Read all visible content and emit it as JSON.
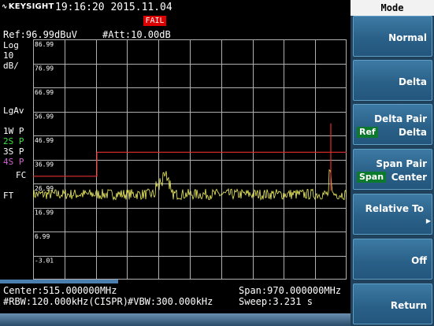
{
  "header": {
    "brand": "KEYSIGHT",
    "datetime": "19:16:20  2015.11.04",
    "fail": "FAIL",
    "ref_level": "Ref:96.99dBuV",
    "attenuation": "#Att:10.00dB"
  },
  "scale": {
    "log": "Log",
    "db": "10",
    "dbdiv": "dB/",
    "y_ticks": [
      "86.99",
      "76.99",
      "66.99",
      "56.99",
      "46.99",
      "36.99",
      "26.99",
      "16.99",
      "6.99",
      "-3.01"
    ]
  },
  "left_labels": {
    "detector": "LgAv",
    "traces": [
      "1W P",
      "2S P",
      "3S P",
      "4S P"
    ],
    "fc": "FC",
    "ft": "FT"
  },
  "footer": {
    "center": "Center:515.000000MHz",
    "span": "Span:970.000000MHz",
    "rbw": "#RBW:120.000kHz(CISPR)",
    "vbw": "#VBW:300.000kHz",
    "sweep": "Sweep:3.231  s"
  },
  "panel": {
    "title": "Mode",
    "keys": {
      "normal": "Normal",
      "delta": "Delta",
      "delta_pair": "Delta Pair",
      "delta_pair_chip": "Ref",
      "delta_pair_sub": "Delta",
      "span_pair": "Span Pair",
      "span_pair_chip": "Span",
      "span_pair_sub": "Center",
      "relative_to": "Relative To",
      "off": "Off",
      "return": "Return"
    }
  },
  "colors": {
    "trace": "#f0f060",
    "limit_line": "#e03030",
    "grid": "#b0b0b0",
    "softkey": "#2a6189",
    "chip": "#0c7a2c"
  }
}
